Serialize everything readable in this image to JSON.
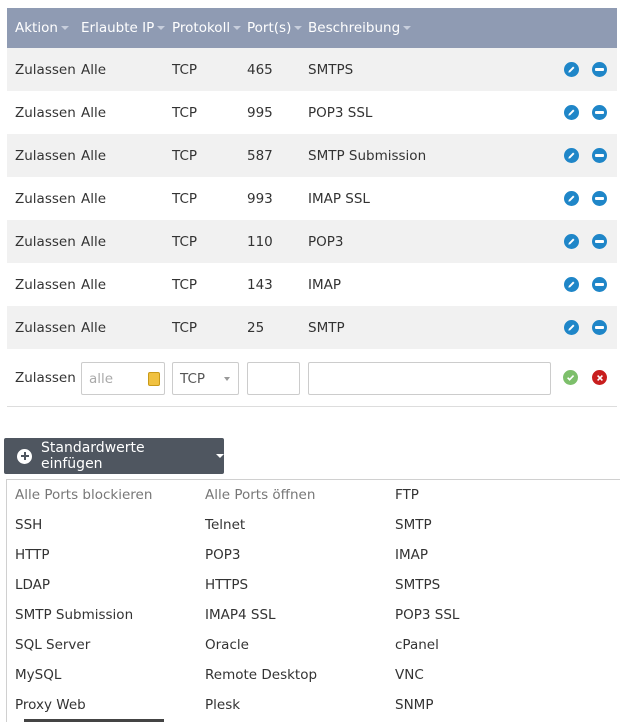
{
  "table": {
    "headers": [
      "Aktion",
      "Erlaubte IP",
      "Protokoll",
      "Port(s)",
      "Beschreibung"
    ],
    "rows": [
      {
        "action": "Zulassen",
        "ip": "Alle",
        "protocol": "TCP",
        "port": "465",
        "description": "SMTPS"
      },
      {
        "action": "Zulassen",
        "ip": "Alle",
        "protocol": "TCP",
        "port": "995",
        "description": "POP3 SSL"
      },
      {
        "action": "Zulassen",
        "ip": "Alle",
        "protocol": "TCP",
        "port": "587",
        "description": "SMTP Submission"
      },
      {
        "action": "Zulassen",
        "ip": "Alle",
        "protocol": "TCP",
        "port": "993",
        "description": "IMAP SSL"
      },
      {
        "action": "Zulassen",
        "ip": "Alle",
        "protocol": "TCP",
        "port": "110",
        "description": "POP3"
      },
      {
        "action": "Zulassen",
        "ip": "Alle",
        "protocol": "TCP",
        "port": "143",
        "description": "IMAP"
      },
      {
        "action": "Zulassen",
        "ip": "Alle",
        "protocol": "TCP",
        "port": "25",
        "description": "SMTP"
      }
    ],
    "new_row": {
      "action": "Zulassen",
      "ip_placeholder": "alle",
      "protocol_selected": "TCP",
      "port_value": "",
      "description_value": ""
    }
  },
  "defaults_button": {
    "label": "Standardwerte einfügen"
  },
  "defaults_menu": {
    "items": [
      "Alle Ports blockieren",
      "Alle Ports öffnen",
      "FTP",
      "SSH",
      "Telnet",
      "SMTP",
      "HTTP",
      "POP3",
      "IMAP",
      "LDAP",
      "HTTPS",
      "SMTPS",
      "SMTP Submission",
      "IMAP4 SSL",
      "POP3 SSL",
      "SQL Server",
      "Oracle",
      "cPanel",
      "MySQL",
      "Remote Desktop",
      "VNC",
      "Proxy Web",
      "Plesk",
      "SNMP"
    ]
  },
  "colors": {
    "header_bg": "#8f9bb3",
    "row_alt": "#f1f1f1",
    "accent": "#1f86c8",
    "ok": "#7dbf6b",
    "cancel": "#c81e1e",
    "button_bg": "#4f5660"
  }
}
